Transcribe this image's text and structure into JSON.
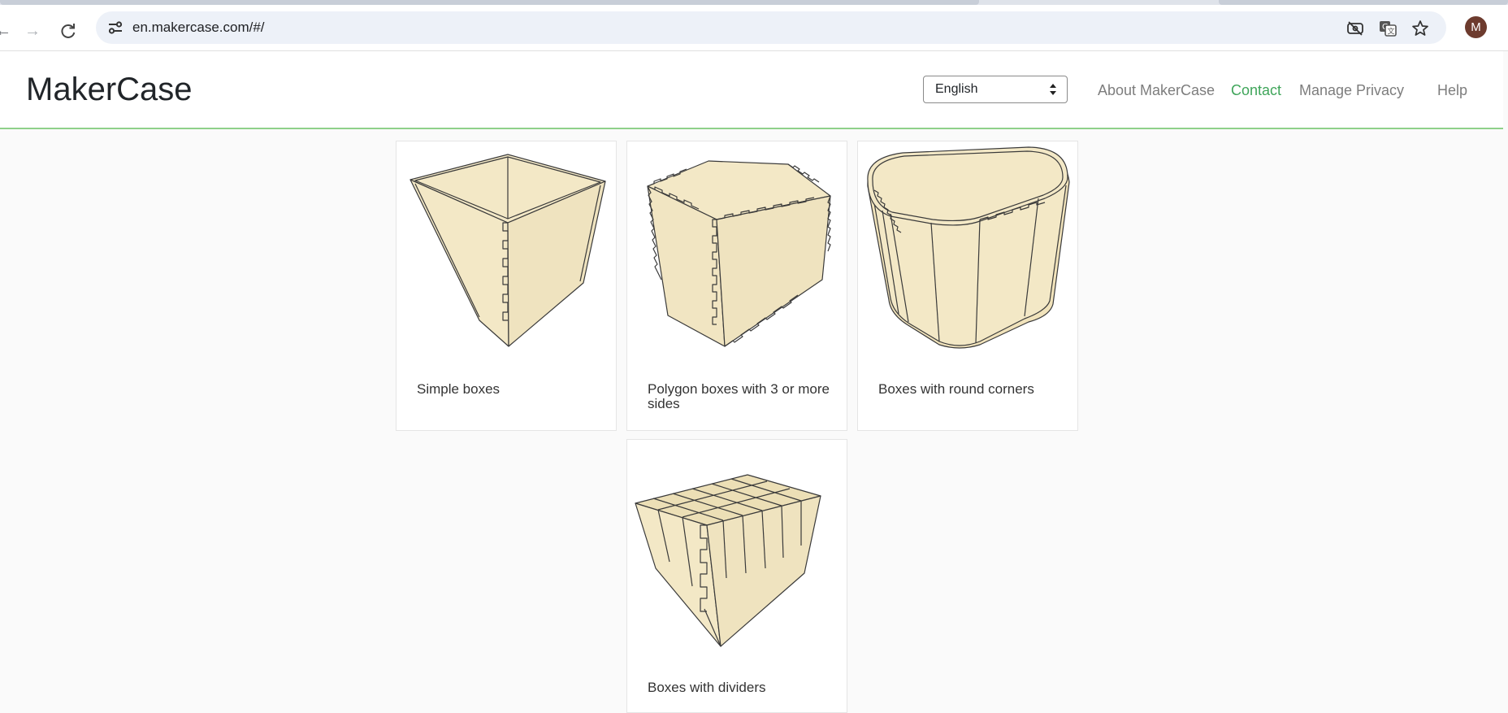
{
  "browser": {
    "url": "en.makercase.com/#/",
    "profile_initial": "M",
    "icons": [
      "back-icon",
      "forward-icon",
      "reload-icon",
      "site-settings-icon",
      "eye-off-icon",
      "translate-icon",
      "bookmark-star-icon"
    ]
  },
  "header": {
    "brand": "MakerCase",
    "language": "English",
    "nav": {
      "about": "About MakerCase",
      "contact": "Contact",
      "privacy": "Manage Privacy",
      "help": "Help"
    },
    "colors": {
      "accent_green": "#3fa55a",
      "header_rule": "#8fd18a",
      "link_gray": "#7d7d7d"
    }
  },
  "cards": [
    {
      "label": "Simple boxes"
    },
    {
      "label": "Polygon boxes with 3 or more sides"
    },
    {
      "label": "Boxes with round corners"
    },
    {
      "label": "Boxes with dividers"
    }
  ],
  "colors": {
    "wood": "#f3e8c6",
    "wood_shade": "#ecdfb6",
    "edge": "#3a3a3a"
  }
}
